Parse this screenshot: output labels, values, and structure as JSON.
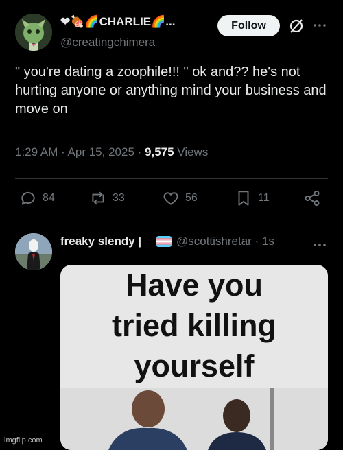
{
  "tweet": {
    "display_name": "❤🍖🌈CHARLIE🌈...",
    "handle": "@creatingchimera",
    "follow_label": "Follow",
    "text": "\" you're dating a zoophile!!! \" ok and?? he's not hurting anyone or anything mind your business and move on",
    "time": "1:29 AM · Apr 15, 2025 · ",
    "views_count": "9,575",
    "views_label": " Views",
    "replies": "84",
    "reposts": "33",
    "likes": "56",
    "bookmarks": "11"
  },
  "reply": {
    "display_name": "freaky slendy |",
    "handle": "@scottishretar · 1s",
    "meme_lines": [
      "Have you",
      "tried killing",
      "yourself"
    ]
  },
  "watermark": "imgflip.com",
  "colors": {
    "background": "#000000",
    "text_primary": "#e7e9ea",
    "text_secondary": "#71767b",
    "divider": "#2f3336",
    "follow_bg": "#eff3f4"
  }
}
